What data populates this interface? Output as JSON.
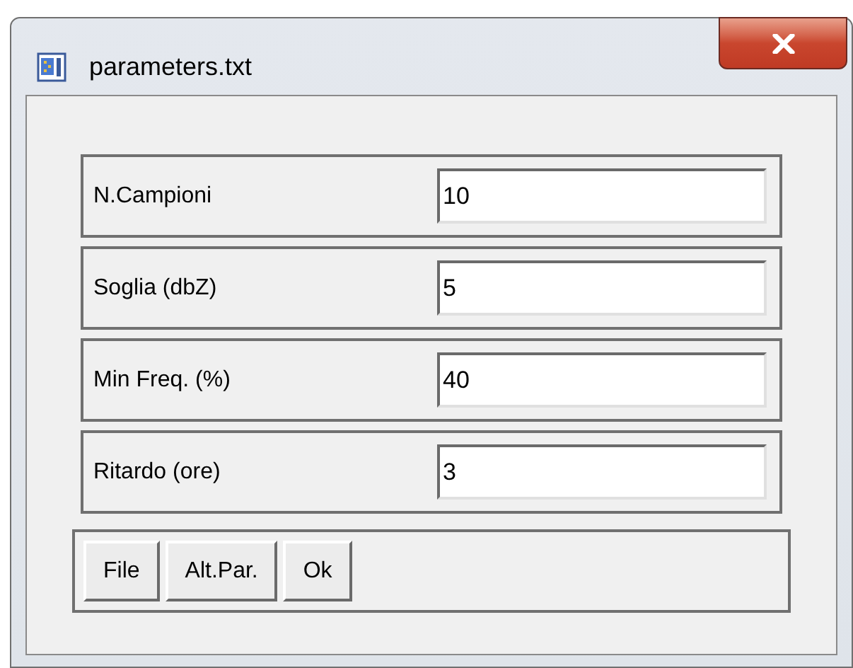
{
  "window": {
    "title": "parameters.txt"
  },
  "fields": [
    {
      "label": "N.Campioni",
      "value": "10"
    },
    {
      "label": "Soglia (dbZ)",
      "value": "5"
    },
    {
      "label": "Min Freq. (%)",
      "value": "40"
    },
    {
      "label": "Ritardo (ore)",
      "value": "3"
    }
  ],
  "buttons": [
    "File",
    "Alt.Par.",
    "Ok"
  ]
}
